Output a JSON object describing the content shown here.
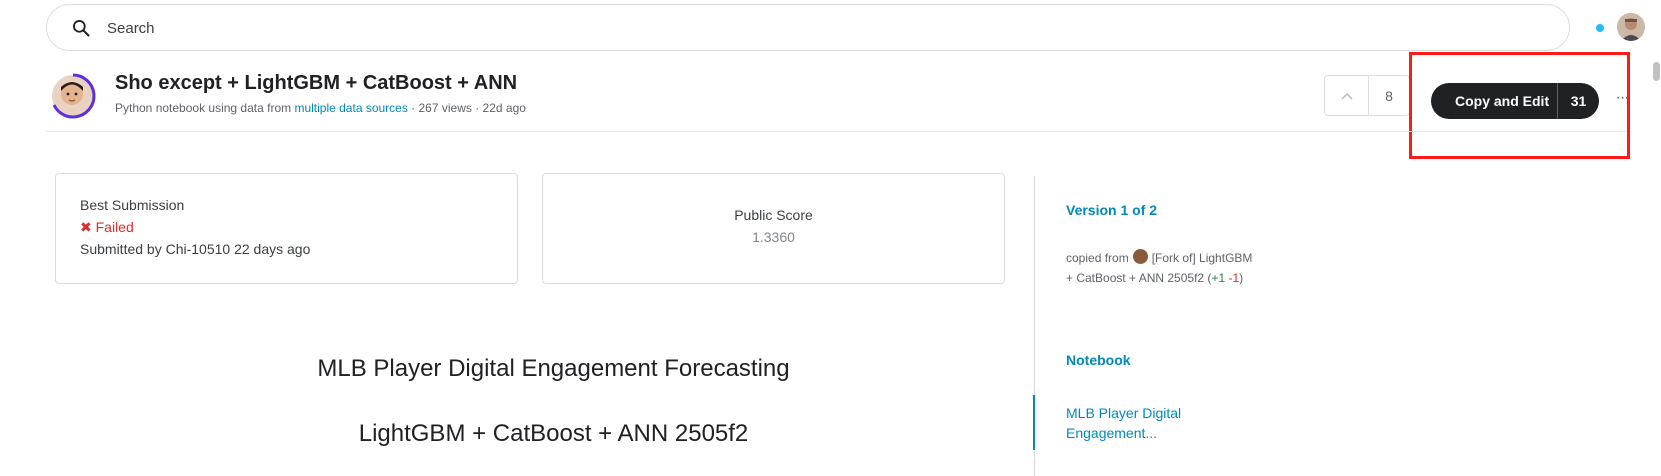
{
  "search": {
    "placeholder": "Search",
    "value": ""
  },
  "notebook": {
    "title": "Sho except + LightGBM + CatBoost + ANN",
    "meta_prefix": "Python notebook using data from ",
    "meta_link": "multiple data sources",
    "meta_suffix": " · 267 views · 22d ago"
  },
  "actions": {
    "vote_count": "8",
    "copy_edit_label": "Copy and Edit",
    "copy_edit_count": "31",
    "more_label": "···"
  },
  "best_submission": {
    "heading": "Best Submission",
    "status_icon": "✖",
    "status_text": "Failed",
    "submitted_by": "Submitted by Chi-10510 22 days ago"
  },
  "public_score": {
    "heading": "Public Score",
    "value": "1.3360"
  },
  "content": {
    "heading_1": "MLB Player Digital Engagement Forecasting",
    "heading_2": "LightGBM + CatBoost + ANN 2505f2"
  },
  "sidebar": {
    "version": "Version 1 of 2",
    "copied_from_label": "copied from",
    "copied_from_title": "[Fork of] LightGBM + CatBoost + ANN 2505f2",
    "diff_open": " (",
    "diff_plus": "+1",
    "diff_space": " ",
    "diff_minus": "-1",
    "diff_close": ")",
    "notebook_link": "Notebook",
    "toc_item": "MLB Player Digital Engagement..."
  },
  "colors": {
    "accent_link": "#008abc",
    "failed_red": "#d93025",
    "button_dark": "#202124",
    "highlight_red": "#ff1a1a",
    "notification_dot": "#20beff"
  }
}
